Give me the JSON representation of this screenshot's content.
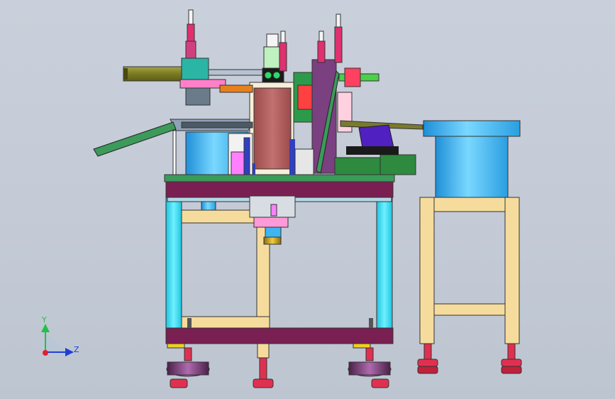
{
  "viewport": {
    "background": "#c6cdd8"
  },
  "triad": {
    "y_label": "Y",
    "z_label": "Z",
    "y_color": "#22c04a",
    "z_color": "#1e3fd6",
    "origin_color": "#e0202a"
  },
  "colors": {
    "frame_maroon": "#7a1f52",
    "leg_cyan": "#2fd8ee",
    "brace_tan": "#f6dc9c",
    "bowl_blue": "#3fb6ef",
    "tower_brown": "#b06060",
    "slide_green": "#3c9a5a",
    "olive_cylinder": "#8a8a2e",
    "foot_purple": "#6b3a6b",
    "foot_red": "#e03050"
  }
}
